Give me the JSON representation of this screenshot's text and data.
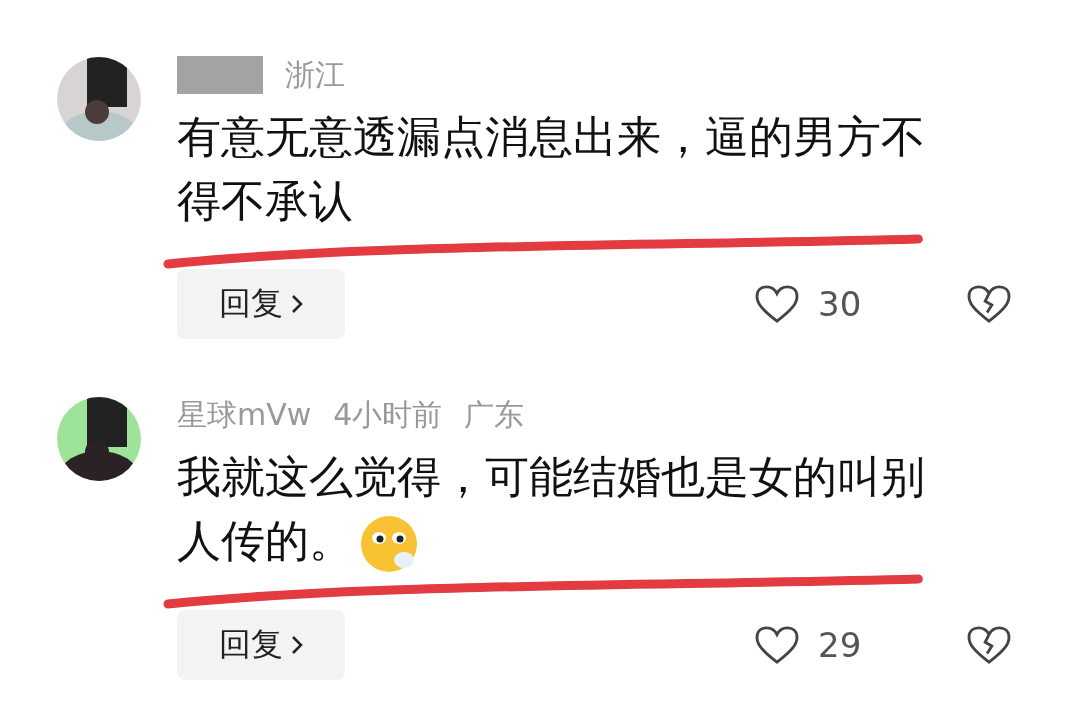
{
  "comments": [
    {
      "region": "浙江",
      "text": "有意无意透漏点消息出来，逼的男方不得不承认",
      "reply": "回复",
      "likes": "30"
    },
    {
      "name": "星球mVw",
      "time": "4小时前",
      "region": "广东",
      "text": "我就这么觉得，可能结婚也是女的叫别人传的。",
      "emoji": true,
      "reply": "回复",
      "likes": "29"
    }
  ]
}
